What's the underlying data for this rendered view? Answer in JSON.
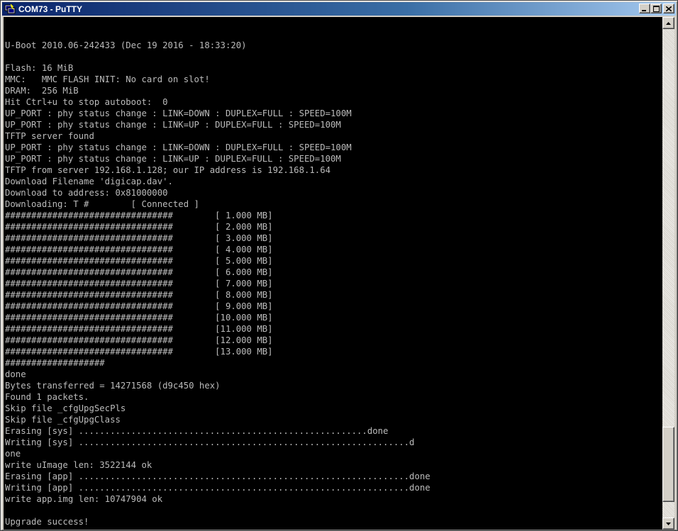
{
  "window": {
    "title": "COM73 - PuTTY",
    "controls": {
      "minimize_icon": "minimize-icon",
      "maximize_icon": "maximize-icon",
      "close_icon": "close-icon"
    }
  },
  "terminal": {
    "background": "#000000",
    "foreground": "#bbbbbb",
    "lines": [
      "",
      "",
      "U-Boot 2010.06-242433 (Dec 19 2016 - 18:33:20)",
      "",
      "Flash: 16 MiB",
      "MMC:   MMC FLASH INIT: No card on slot!",
      "DRAM:  256 MiB",
      "Hit Ctrl+u to stop autoboot:  0",
      "UP_PORT : phy status change : LINK=DOWN : DUPLEX=FULL : SPEED=100M",
      "UP_PORT : phy status change : LINK=UP : DUPLEX=FULL : SPEED=100M",
      "TFTP server found",
      "UP_PORT : phy status change : LINK=DOWN : DUPLEX=FULL : SPEED=100M",
      "UP_PORT : phy status change : LINK=UP : DUPLEX=FULL : SPEED=100M",
      "TFTP from server 192.168.1.128; our IP address is 192.168.1.64",
      "Download Filename 'digicap.dav'.",
      "Download to address: 0x81000000",
      "Downloading: T #        [ Connected ]",
      "################################        [ 1.000 MB]",
      "################################        [ 2.000 MB]",
      "################################        [ 3.000 MB]",
      "################################        [ 4.000 MB]",
      "################################        [ 5.000 MB]",
      "################################        [ 6.000 MB]",
      "################################        [ 7.000 MB]",
      "################################        [ 8.000 MB]",
      "################################        [ 9.000 MB]",
      "################################        [10.000 MB]",
      "################################        [11.000 MB]",
      "################################        [12.000 MB]",
      "################################        [13.000 MB]",
      "###################",
      "done",
      "Bytes transferred = 14271568 (d9c450 hex)",
      "Found 1 packets.",
      "Skip file _cfgUpgSecPls",
      "Skip file _cfgUpgClass",
      "Erasing [sys] .......................................................done",
      "Writing [sys] ...............................................................d",
      "one",
      "write uImage len: 3522144 ok",
      "Erasing [app] ...............................................................done",
      "Writing [app] ...............................................................done",
      "write app.img len: 10747904 ok",
      "",
      "Upgrade success!"
    ]
  },
  "scrollbar": {
    "up_icon": "scroll-up-arrow-icon",
    "down_icon": "scroll-down-arrow-icon"
  }
}
